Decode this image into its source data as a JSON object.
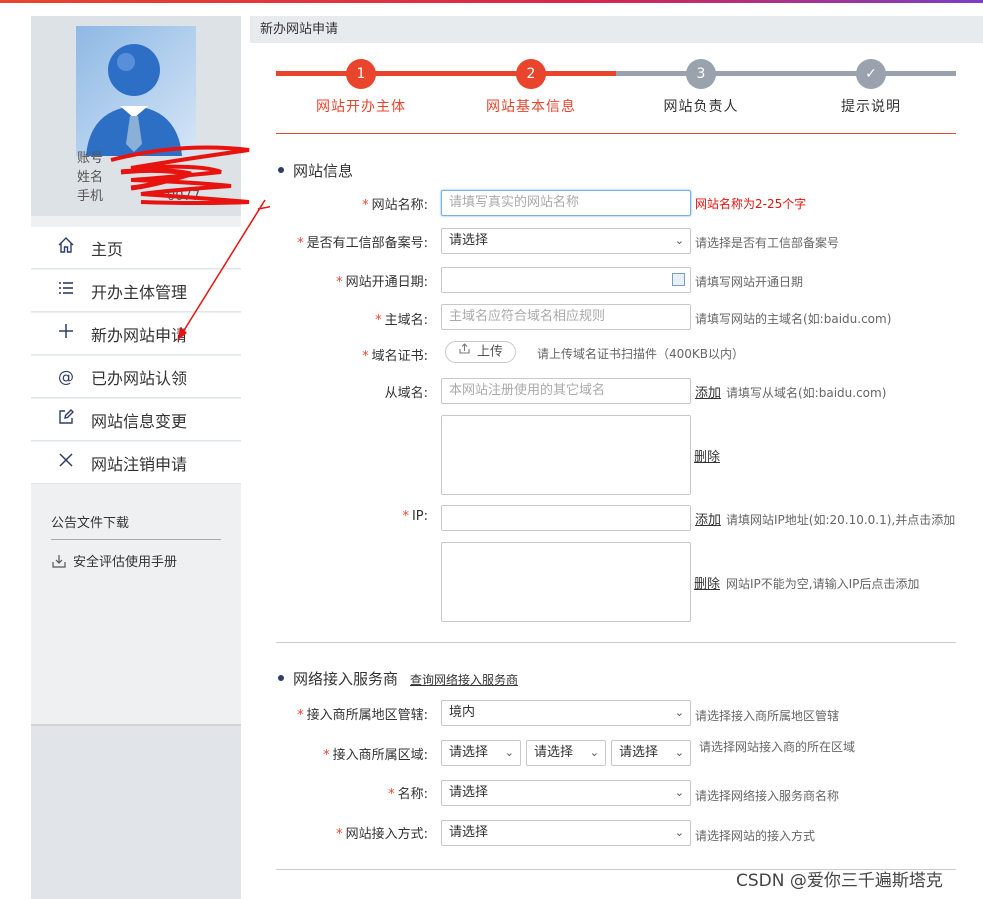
{
  "sidebar": {
    "profile": {
      "account_label": "账号",
      "name_label": "姓名",
      "phone_label": "手机",
      "account_value": "",
      "name_value": "",
      "phone_value": "0077"
    },
    "nav": [
      {
        "icon": "home-icon",
        "label": "主页"
      },
      {
        "icon": "list-icon",
        "label": "开办主体管理"
      },
      {
        "icon": "plus-icon",
        "label": "新办网站申请"
      },
      {
        "icon": "at-icon",
        "label": "已办网站认领"
      },
      {
        "icon": "edit-icon",
        "label": "网站信息变更"
      },
      {
        "icon": "close-icon",
        "label": "网站注销申请"
      }
    ],
    "announce": {
      "title": "公告文件下载",
      "item": "安全评估使用手册"
    }
  },
  "panel": {
    "title": "新办网站申请"
  },
  "steps": [
    {
      "num": "1",
      "label": "网站开办主体",
      "state": "done"
    },
    {
      "num": "2",
      "label": "网站基本信息",
      "state": "active"
    },
    {
      "num": "3",
      "label": "网站负责人",
      "state": "todo"
    },
    {
      "num": "✓",
      "label": "提示说明",
      "state": "todo"
    }
  ],
  "colors": {
    "accent": "#e8452c",
    "inactive": "#99a2ad",
    "navy": "#2c3e66"
  },
  "site_info": {
    "section_title": "网站信息",
    "site_name": {
      "label": "网站名称:",
      "placeholder": "请填写真实的网站名称",
      "hint": "网站名称为2-25个字"
    },
    "icp": {
      "label": "是否有工信部备案号:",
      "value": "请选择",
      "hint": "请选择是否有工信部备案号"
    },
    "open_date": {
      "label": "网站开通日期:",
      "value": "",
      "hint": "请填写网站开通日期"
    },
    "main_domain": {
      "label": "主域名:",
      "placeholder": "主域名应符合域名相应规则",
      "hint": "请填写网站的主域名(如:baidu.com)"
    },
    "cert": {
      "label": "域名证书:",
      "button": "上传",
      "hint": "请上传域名证书扫描件（400KB以内）"
    },
    "sub_domain": {
      "label": "从域名:",
      "placeholder": "本网站注册使用的其它域名",
      "add": "添加",
      "hint": "请填写从域名(如:baidu.com)",
      "delete": "删除"
    },
    "ip": {
      "label": "IP:",
      "value": "",
      "add": "添加",
      "hint": "请填网站IP地址(如:20.10.0.1),并点击添加",
      "delete": "删除",
      "delete_hint": "网站IP不能为空,请输入IP后点击添加"
    }
  },
  "isp": {
    "section_title": "网络接入服务商",
    "query_link": "查询网络接入服务商",
    "region_type": {
      "label": "接入商所属地区管辖:",
      "value": "境内",
      "hint": "请选择接入商所属地区管辖"
    },
    "region": {
      "label": "接入商所属区域:",
      "values": [
        "请选择",
        "请选择",
        "请选择"
      ],
      "hint": "请选择网站接入商的所在区域"
    },
    "name": {
      "label": "名称:",
      "value": "请选择",
      "hint": "请选择网络接入服务商名称"
    },
    "access": {
      "label": "网站接入方式:",
      "value": "请选择",
      "hint": "请选择网站的接入方式"
    }
  },
  "watermark": "CSDN @爱你三千遍斯塔克"
}
